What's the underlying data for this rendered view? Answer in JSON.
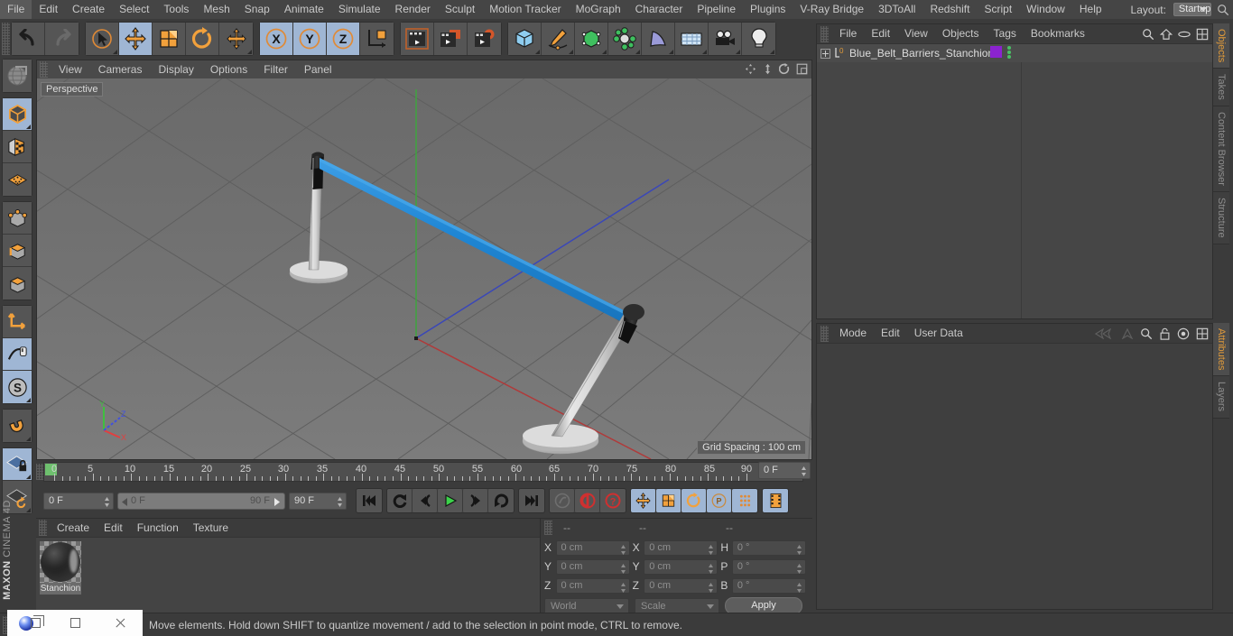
{
  "app": {
    "brand_line1": "MAXON",
    "brand_line2": "CINEMA 4D"
  },
  "menubar": {
    "items": [
      "File",
      "Edit",
      "Create",
      "Select",
      "Tools",
      "Mesh",
      "Snap",
      "Animate",
      "Simulate",
      "Render",
      "Sculpt",
      "Motion Tracker",
      "MoGraph",
      "Character",
      "Pipeline",
      "Plugins",
      "V-Ray Bridge",
      "3DToAll",
      "Redshift",
      "Script",
      "Window",
      "Help"
    ],
    "layout_label": "Layout:",
    "layout_value": "Startup"
  },
  "toolbar": {
    "undo": "undo-arrow",
    "redo": "redo-arrow",
    "select": "live-selection",
    "move": "move-tool",
    "scale": "scale-tool",
    "rotate": "rotate-tool",
    "move2": "move-axis-tool",
    "x": "X",
    "y": "Y",
    "z": "Z",
    "world": "world-object-axis",
    "render_view": "render-view",
    "render_region": "render-region",
    "render_settings": "render-settings",
    "cube": "primitive-cube",
    "spline": "spline-pen",
    "nurbs": "generator",
    "array": "mograph-array",
    "bend": "deformer",
    "floor": "environment-floor",
    "camera": "camera",
    "light": "light"
  },
  "viewport": {
    "menu": [
      "View",
      "Cameras",
      "Display",
      "Options",
      "Filter",
      "Panel"
    ],
    "label": "Perspective",
    "grid_spacing": "Grid Spacing : 100 cm",
    "axis": {
      "x": "X",
      "y": "Y",
      "z": "Z"
    },
    "icons": [
      "pan-icon",
      "zoom-icon",
      "rotate-icon",
      "maximize-icon"
    ],
    "scene": {
      "object": "Blue_Belt_Barriers_Stanchion",
      "belt_color": "#2089d8",
      "post_color": "#d6d6d6",
      "cap_color": "#1a1a1a"
    }
  },
  "timeline": {
    "ticks": [
      0,
      5,
      10,
      15,
      20,
      25,
      30,
      35,
      40,
      45,
      50,
      55,
      60,
      65,
      70,
      75,
      80,
      85,
      90
    ],
    "current_frame_field": "0 F",
    "range_start": "0 F",
    "range_end": "90 F",
    "max_frame_field": "90 F",
    "frame_display": "0 F",
    "buttons": [
      "go-to-start",
      "rewind",
      "step-back",
      "play",
      "step-forward",
      "loop",
      "go-to-end",
      "record-active-objects",
      "record-keyframe",
      "autokeying",
      "keyframe-selection"
    ],
    "key_toggles": [
      "position-key",
      "scale-key",
      "rotation-key",
      "parameter-key",
      "point-level-animation",
      "timeline-toggle"
    ]
  },
  "material_manager": {
    "menu": [
      "Create",
      "Edit",
      "Function",
      "Texture"
    ],
    "materials": [
      {
        "name": "Stanchion"
      }
    ]
  },
  "coordinates": {
    "headers": [
      "--",
      "--",
      "--"
    ],
    "rows": [
      {
        "pos_label": "X",
        "pos_value": "0 cm",
        "size_label": "X",
        "size_value": "0 cm",
        "rot_label": "H",
        "rot_value": "0 °"
      },
      {
        "pos_label": "Y",
        "pos_value": "0 cm",
        "size_label": "Y",
        "size_value": "0 cm",
        "rot_label": "P",
        "rot_value": "0 °"
      },
      {
        "pos_label": "Z",
        "pos_value": "0 cm",
        "size_label": "Z",
        "size_value": "0 cm",
        "rot_label": "B",
        "rot_value": "0 °"
      }
    ],
    "system": "World",
    "mode": "Scale",
    "apply": "Apply"
  },
  "object_manager": {
    "menu": [
      "File",
      "Edit",
      "View",
      "Objects",
      "Tags",
      "Bookmarks"
    ],
    "icons": [
      "search-icon",
      "home-icon",
      "eye-icon",
      "layout-icon"
    ],
    "objects": [
      {
        "name": "Blue_Belt_Barriers_Stanchion",
        "icon": "null-object-icon",
        "tag_material": "#8b23cf",
        "visibility_dots": "#49c265"
      }
    ]
  },
  "attribute_manager": {
    "menu": [
      "Mode",
      "Edit",
      "User Data"
    ],
    "icons": [
      "back-icon",
      "forward-icon",
      "search-icon",
      "lock-icon",
      "target-icon",
      "layout-icon"
    ]
  },
  "right_tabs_top": [
    {
      "label": "Objects",
      "active": true
    },
    {
      "label": "Takes",
      "active": false
    },
    {
      "label": "Content Browser",
      "active": false
    },
    {
      "label": "Structure",
      "active": false
    }
  ],
  "right_tabs_bottom": [
    {
      "label": "Attributes",
      "active": true
    },
    {
      "label": "Layers",
      "active": false
    }
  ],
  "statusbar": {
    "text": "Move elements. Hold down SHIFT to quantize movement / add to the selection in point mode, CTRL to remove."
  },
  "taskbar": {
    "items": [
      "app-logo",
      "restore-button",
      "maximize-button",
      "close-button"
    ]
  }
}
